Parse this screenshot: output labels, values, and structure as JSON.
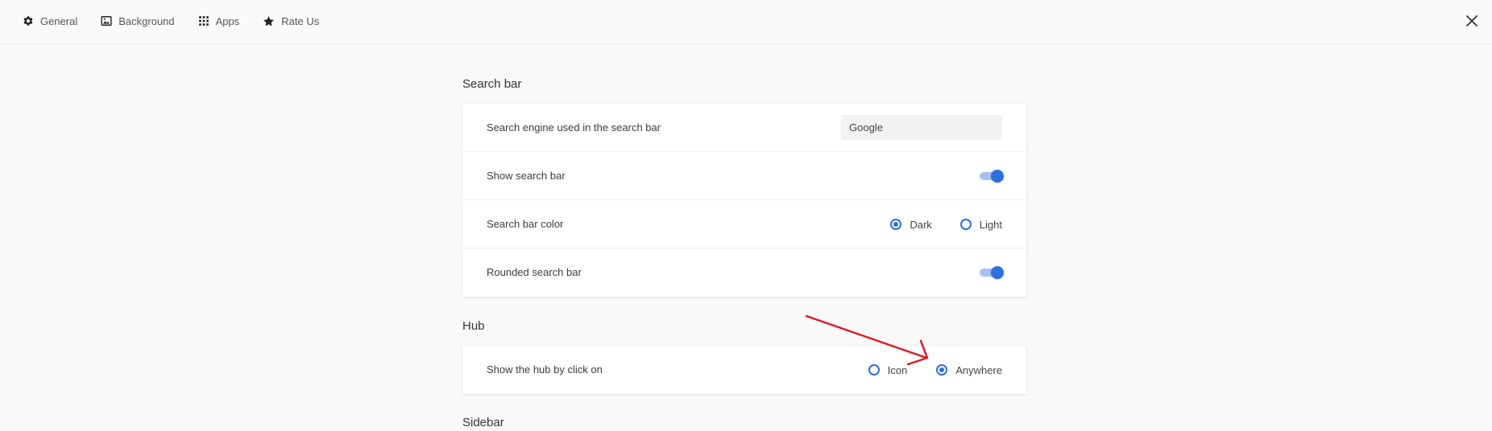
{
  "nav": {
    "items": [
      {
        "label": "General",
        "icon": "gear-icon"
      },
      {
        "label": "Background",
        "icon": "image-icon"
      },
      {
        "label": "Apps",
        "icon": "grid-icon"
      },
      {
        "label": "Rate Us",
        "icon": "star-icon"
      }
    ],
    "close_icon": "close-icon"
  },
  "search_bar": {
    "title": "Search bar",
    "engine": {
      "label": "Search engine used in the search bar",
      "value": "Google"
    },
    "show": {
      "label": "Show search bar",
      "enabled": true
    },
    "color": {
      "label": "Search bar color",
      "options": [
        "Dark",
        "Light"
      ],
      "selected": "Dark"
    },
    "rounded": {
      "label": "Rounded search bar",
      "enabled": true
    }
  },
  "hub": {
    "title": "Hub",
    "click_on": {
      "label": "Show the hub by click on",
      "options": [
        "Icon",
        "Anywhere"
      ],
      "selected": "Anywhere"
    }
  },
  "sidebar": {
    "title": "Sidebar"
  },
  "colors": {
    "accent": "#2b6fe0",
    "annotation": "#e8141b"
  }
}
